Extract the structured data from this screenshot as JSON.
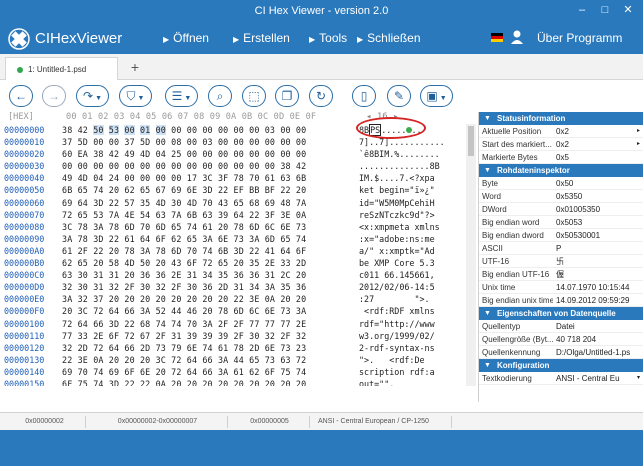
{
  "window": {
    "title": "CI Hex Viewer - version 2.0",
    "minimize": "–",
    "maximize": "□",
    "close": "✕"
  },
  "menu": {
    "app_name": "CIHexViewer",
    "items": [
      "Öffnen",
      "Erstellen",
      "Tools",
      "Schließen"
    ],
    "about": "Über Programm"
  },
  "tab": {
    "label": "1: Untitled-1.psd",
    "plus": "+"
  },
  "hex_header": {
    "label": "[HEX]",
    "columns": "00 01 02 03 04 05 06 07 08 09 0A 0B 0C 0D 0E 0F",
    "nav": "◂ 16 ▸"
  },
  "hex_rows": [
    {
      "offset": "00000000",
      "hex": [
        "38",
        "42",
        "50",
        "53",
        "00",
        "01",
        "00",
        "00",
        "00",
        "00",
        "00",
        "00",
        "00",
        "03",
        "00",
        "00"
      ],
      "ascii_pre": "8B",
      "ascii_cursor": "PS",
      "ascii_post": "........"
    },
    {
      "offset": "00000010",
      "hex": [
        "37",
        "5D",
        "00",
        "00",
        "37",
        "5D",
        "00",
        "08",
        "00",
        "03",
        "00",
        "00",
        "00",
        "00",
        "00",
        "00"
      ],
      "ascii": "7]..7]..........."
    },
    {
      "offset": "00000020",
      "hex": [
        "60",
        "EA",
        "38",
        "42",
        "49",
        "4D",
        "04",
        "25",
        "00",
        "00",
        "00",
        "00",
        "00",
        "00",
        "00",
        "00"
      ],
      "ascii": "`ê8BIM.%........"
    },
    {
      "offset": "00000030",
      "hex": [
        "00",
        "00",
        "00",
        "00",
        "00",
        "00",
        "00",
        "00",
        "00",
        "00",
        "00",
        "00",
        "00",
        "00",
        "38",
        "42"
      ],
      "ascii": "..............8B"
    },
    {
      "offset": "00000040",
      "hex": [
        "49",
        "4D",
        "04",
        "24",
        "00",
        "00",
        "00",
        "00",
        "17",
        "3C",
        "3F",
        "78",
        "70",
        "61",
        "63",
        "6B"
      ],
      "ascii": "IM.$....7.<?xpa"
    },
    {
      "offset": "00000050",
      "hex": [
        "6B",
        "65",
        "74",
        "20",
        "62",
        "65",
        "67",
        "69",
        "6E",
        "3D",
        "22",
        "EF",
        "BB",
        "BF",
        "22",
        "20"
      ],
      "ascii": "ket begin=\"ï»¿\" "
    },
    {
      "offset": "00000060",
      "hex": [
        "69",
        "64",
        "3D",
        "22",
        "57",
        "35",
        "4D",
        "30",
        "4D",
        "70",
        "43",
        "65",
        "68",
        "69",
        "48",
        "7A"
      ],
      "ascii": "id=\"W5M0MpCehiH"
    },
    {
      "offset": "00000070",
      "hex": [
        "72",
        "65",
        "53",
        "7A",
        "4E",
        "54",
        "63",
        "7A",
        "6B",
        "63",
        "39",
        "64",
        "22",
        "3F",
        "3E",
        "0A"
      ],
      "ascii": "reSzNTczkc9d\"?>"
    },
    {
      "offset": "00000080",
      "hex": [
        "3C",
        "78",
        "3A",
        "78",
        "6D",
        "70",
        "6D",
        "65",
        "74",
        "61",
        "20",
        "78",
        "6D",
        "6C",
        "6E",
        "73"
      ],
      "ascii": "<x:xmpmeta xmlns"
    },
    {
      "offset": "00000090",
      "hex": [
        "3A",
        "78",
        "3D",
        "22",
        "61",
        "64",
        "6F",
        "62",
        "65",
        "3A",
        "6E",
        "73",
        "3A",
        "6D",
        "65",
        "74"
      ],
      "ascii": ":x=\"adobe:ns:me"
    },
    {
      "offset": "000000A0",
      "hex": [
        "61",
        "2F",
        "22",
        "20",
        "78",
        "3A",
        "78",
        "6D",
        "70",
        "74",
        "6B",
        "3D",
        "22",
        "41",
        "64",
        "6F"
      ],
      "ascii": "a/\" x:xmptk=\"Ad"
    },
    {
      "offset": "000000B0",
      "hex": [
        "62",
        "65",
        "20",
        "58",
        "4D",
        "50",
        "20",
        "43",
        "6F",
        "72",
        "65",
        "20",
        "35",
        "2E",
        "33",
        "2D"
      ],
      "ascii": "be XMP Core 5.3"
    },
    {
      "offset": "000000C0",
      "hex": [
        "63",
        "30",
        "31",
        "31",
        "20",
        "36",
        "36",
        "2E",
        "31",
        "34",
        "35",
        "36",
        "36",
        "31",
        "2C",
        "20"
      ],
      "ascii": "c011 66.145661,"
    },
    {
      "offset": "000000D0",
      "hex": [
        "32",
        "30",
        "31",
        "32",
        "2F",
        "30",
        "32",
        "2F",
        "30",
        "36",
        "2D",
        "31",
        "34",
        "3A",
        "35",
        "36"
      ],
      "ascii": "2012/02/06-14:5"
    },
    {
      "offset": "000000E0",
      "hex": [
        "3A",
        "32",
        "37",
        "20",
        "20",
        "20",
        "20",
        "20",
        "20",
        "20",
        "20",
        "22",
        "3E",
        "0A",
        "20",
        "20"
      ],
      "ascii": ":27        \">."
    },
    {
      "offset": "000000F0",
      "hex": [
        "20",
        "3C",
        "72",
        "64",
        "66",
        "3A",
        "52",
        "44",
        "46",
        "20",
        "78",
        "6D",
        "6C",
        "6E",
        "73",
        "3A"
      ],
      "ascii": " <rdf:RDF xmlns"
    },
    {
      "offset": "00000100",
      "hex": [
        "72",
        "64",
        "66",
        "3D",
        "22",
        "68",
        "74",
        "74",
        "70",
        "3A",
        "2F",
        "2F",
        "77",
        "77",
        "77",
        "2E"
      ],
      "ascii": "rdf=\"http://www"
    },
    {
      "offset": "00000110",
      "hex": [
        "77",
        "33",
        "2E",
        "6F",
        "72",
        "67",
        "2F",
        "31",
        "39",
        "39",
        "39",
        "2F",
        "30",
        "32",
        "2F",
        "32"
      ],
      "ascii": "w3.org/1999/02/"
    },
    {
      "offset": "00000120",
      "hex": [
        "32",
        "2D",
        "72",
        "64",
        "66",
        "2D",
        "73",
        "79",
        "6E",
        "74",
        "61",
        "78",
        "2D",
        "6E",
        "73",
        "23"
      ],
      "ascii": "2-rdf-syntax-ns"
    },
    {
      "offset": "00000130",
      "hex": [
        "22",
        "3E",
        "0A",
        "20",
        "20",
        "20",
        "3C",
        "72",
        "64",
        "66",
        "3A",
        "44",
        "65",
        "73",
        "63",
        "72"
      ],
      "ascii": "\">.   <rdf:De"
    },
    {
      "offset": "00000140",
      "hex": [
        "69",
        "70",
        "74",
        "69",
        "6F",
        "6E",
        "20",
        "72",
        "64",
        "66",
        "3A",
        "61",
        "62",
        "6F",
        "75",
        "74"
      ],
      "ascii": "scription rdf:a"
    },
    {
      "offset": "00000150",
      "hex": [
        "6F",
        "75",
        "74",
        "3D",
        "22",
        "22",
        "0A",
        "20",
        "20",
        "20",
        "20",
        "20",
        "20",
        "20",
        "20",
        "20"
      ],
      "ascii": "out=\"\"."
    }
  ],
  "panel": {
    "sections": [
      {
        "title": "Statusinformation",
        "rows": [
          {
            "k": "Aktuelle Position",
            "v": "0x2",
            "arrow": "▸"
          },
          {
            "k": "Start des markiert...",
            "v": "0x2",
            "arrow": "▸"
          },
          {
            "k": "Markierte Bytes",
            "v": "0x5",
            "arrow": ""
          }
        ]
      },
      {
        "title": "Rohdateninspektor",
        "rows": [
          {
            "k": "Byte",
            "v": "0x50",
            "arrow": ""
          },
          {
            "k": "Word",
            "v": "0x5350",
            "arrow": ""
          },
          {
            "k": "DWord",
            "v": "0x01005350",
            "arrow": ""
          },
          {
            "k": "Big endian word",
            "v": "0x5053",
            "arrow": ""
          },
          {
            "k": "Big endian dword",
            "v": "0x50530001",
            "arrow": ""
          },
          {
            "k": "ASCII",
            "v": "P",
            "arrow": ""
          },
          {
            "k": "UTF-16",
            "v": "卐",
            "arrow": ""
          },
          {
            "k": "Big endian UTF-16",
            "v": "偓",
            "arrow": ""
          },
          {
            "k": "Unix time",
            "v": "14.07.1970 10:15:44",
            "arrow": ""
          },
          {
            "k": "Big endian unix time",
            "v": "14.09.2012 09:59:29",
            "arrow": ""
          }
        ]
      },
      {
        "title": "Eigenschaften von Datenquelle",
        "rows": [
          {
            "k": "Quellentyp",
            "v": "Datei",
            "arrow": ""
          },
          {
            "k": "Quellengröße (Byt...",
            "v": "40 718 204",
            "arrow": ""
          },
          {
            "k": "Quellenkennung",
            "v": "D:/Olga/Untitled-1.ps",
            "arrow": ""
          }
        ]
      },
      {
        "title": "Konfiguration",
        "rows": [
          {
            "k": "Textkodierung",
            "v": "ANSI - Central Eu",
            "arrow": "▾"
          }
        ]
      }
    ]
  },
  "status": {
    "pos": "0x00000002",
    "range": "0x00000002-0x00000007",
    "size": "0x00000005",
    "encoding": "ANSI - Central European / CP-1250"
  },
  "colors": {
    "accent": "#2a79bd",
    "selection": "#cfe2f5",
    "annotation": "#d42424"
  }
}
